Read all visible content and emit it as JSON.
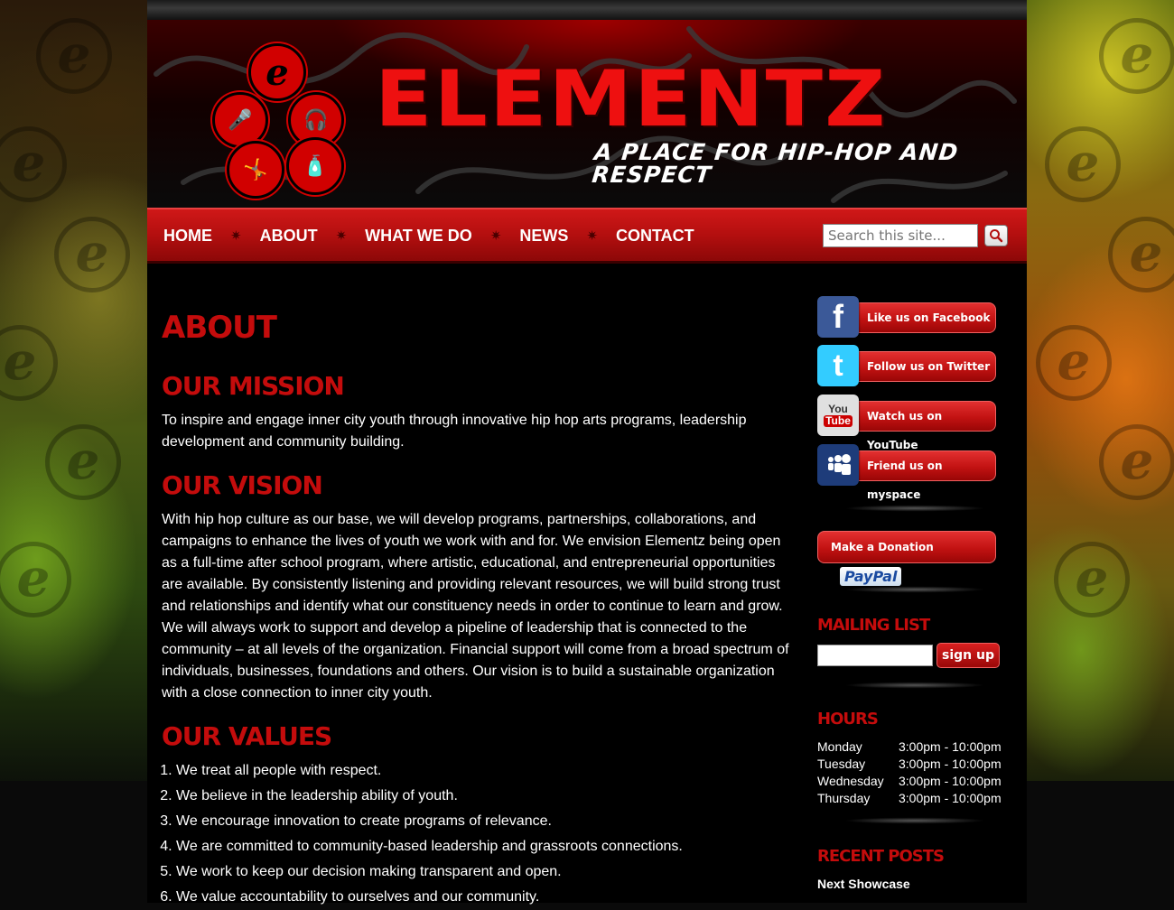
{
  "site": {
    "brand": "ELEMENTZ",
    "tagline": "A PLACE FOR HIP-HOP AND RESPECT"
  },
  "nav": {
    "items": [
      "HOME",
      "ABOUT",
      "WHAT WE DO",
      "NEWS",
      "CONTACT"
    ],
    "search_placeholder": "Search this site..."
  },
  "main": {
    "page_title": "ABOUT",
    "mission_heading": "OUR MISSION",
    "mission_text": "To inspire and engage inner city youth through innovative hip hop arts programs, leadership development and community building.",
    "vision_heading": "OUR VISION",
    "vision_text": "With hip hop culture as our base, we will develop programs, partnerships, collaborations, and campaigns to enhance the lives of youth we work with and for. We envision Elementz being open as a full-time after school program, where artistic, educational, and entrepreneurial opportunities are available. By consistently listening and providing relevant resources, we will build strong trust and relationships and identify what our constituency needs in order to continue to learn and grow. We will always work to support and develop a pipeline of leadership that is connected to the community – at all levels of the organization. Financial support will come from a broad spectrum of individuals, businesses, foundations and others. Our vision is to build a sustainable organization with a close connection to inner city youth.",
    "values_heading": "OUR VALUES",
    "values": [
      "We treat all people with respect.",
      "We believe in the leadership ability of youth.",
      "We encourage innovation to create programs of relevance.",
      "We are committed to community-based leadership and grassroots connections.",
      "We work to keep our decision making transparent and open.",
      "We value accountability to ourselves and our community."
    ]
  },
  "sidebar": {
    "social": [
      {
        "label": "Like us on Facebook",
        "icon": "facebook-icon",
        "icon_text": "f",
        "color": "#3b5998"
      },
      {
        "label": "Follow us on Twitter",
        "icon": "twitter-icon",
        "icon_text": "t",
        "color": "#33ccff"
      },
      {
        "label": "Watch us on YouTube",
        "icon": "youtube-icon",
        "icon_text": "You",
        "color": "#d9d9d9"
      },
      {
        "label": "Friend us on myspace",
        "icon": "myspace-icon",
        "icon_text": "",
        "color": "#1e3c7a"
      }
    ],
    "donate_label": "Make a Donation",
    "paypal_label": "PayPal",
    "mailing_heading": "MAILING LIST",
    "signup_label": "sign up",
    "hours_heading": "HOURS",
    "hours": [
      {
        "day": "Monday",
        "time": "3:00pm - 10:00pm"
      },
      {
        "day": "Tuesday",
        "time": "3:00pm - 10:00pm"
      },
      {
        "day": "Wednesday",
        "time": "3:00pm - 10:00pm"
      },
      {
        "day": "Thursday",
        "time": "3:00pm - 10:00pm"
      }
    ],
    "recent_heading": "RECENT POSTS",
    "recent_posts": [
      "Next Showcase"
    ]
  },
  "colors": {
    "accent": "#c40c0c",
    "nav": "#b30f0f",
    "background": "#000000"
  }
}
